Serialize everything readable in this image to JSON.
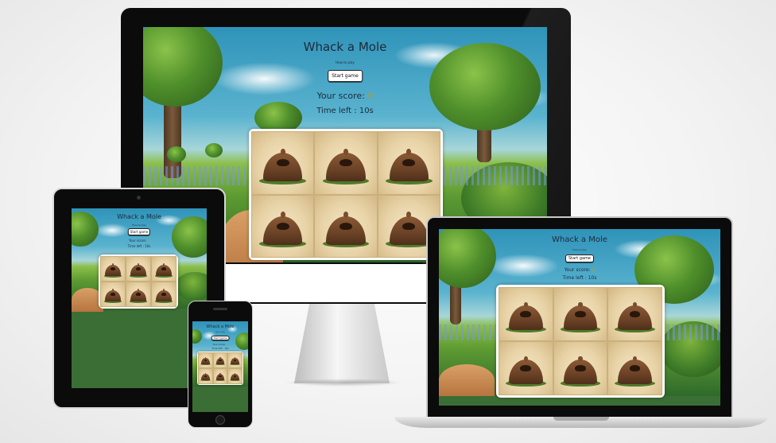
{
  "game": {
    "title": "Whack a Mole",
    "subtitle": "How to play",
    "start_label": "Start game",
    "score_label": "Your score:",
    "score_value": "0",
    "time_label": "Time left :",
    "time_value": "10s"
  },
  "board": {
    "holes": [
      "mole-hole",
      "mole-hole",
      "mole-hole",
      "mole-hole",
      "mole-hole",
      "mole-hole"
    ]
  },
  "devices": [
    "desktop-monitor",
    "tablet",
    "laptop",
    "phone"
  ],
  "colors": {
    "background": "#f1f1f1",
    "screen_fill": "#3b6e35",
    "score_accent": "#b59a2c",
    "bezel": "#0b0b0b"
  }
}
